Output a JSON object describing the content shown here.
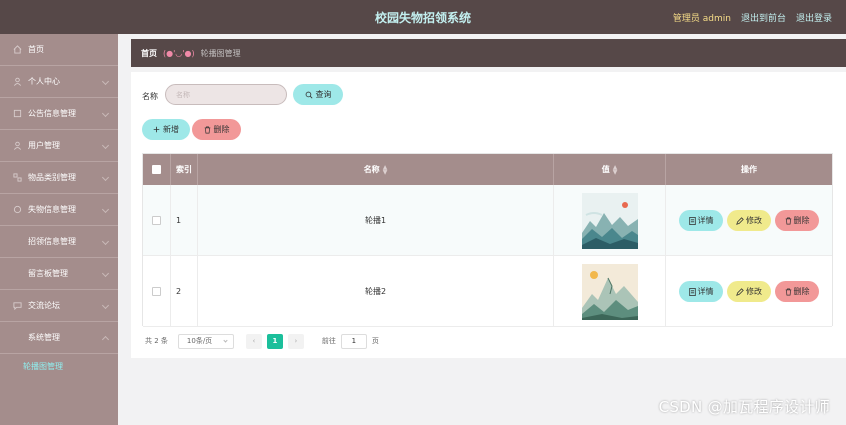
{
  "header": {
    "title": "校园失物招领系统",
    "admin_label": "管理员 admin",
    "back_label": "退出到前台",
    "logout_label": "退出登录"
  },
  "sidebar": {
    "items": [
      {
        "label": "首页",
        "icon": "home-icon"
      },
      {
        "label": "个人中心",
        "icon": "user-icon"
      },
      {
        "label": "公告信息管理",
        "icon": "notice-icon"
      },
      {
        "label": "用户管理",
        "icon": "users-icon"
      },
      {
        "label": "物品类别管理",
        "icon": "category-icon"
      },
      {
        "label": "失物信息管理",
        "icon": "lost-icon"
      },
      {
        "label": "招领信息管理"
      },
      {
        "label": "留言板管理"
      },
      {
        "label": "交流论坛",
        "icon": "forum-icon"
      },
      {
        "label": "系统管理"
      },
      {
        "label": "轮播图管理"
      }
    ]
  },
  "breadcrumb": {
    "home": "首页",
    "face": "(●'◡'●)",
    "current": "轮播图管理"
  },
  "search": {
    "label": "名称",
    "placeholder": "名称",
    "query_label": "查询"
  },
  "toolbar": {
    "add_label": "新增",
    "delete_label": "删除"
  },
  "table": {
    "columns": {
      "index": "索引",
      "name": "名称",
      "value": "值",
      "action": "操作"
    },
    "rows": [
      {
        "index": "1",
        "name": "轮播1"
      },
      {
        "index": "2",
        "name": "轮播2"
      }
    ],
    "actions": {
      "detail": "详情",
      "edit": "修改",
      "delete": "删除"
    }
  },
  "pagination": {
    "total": "共 2 条",
    "page_size": "10条/页",
    "current_page": "1",
    "goto_label": "前往",
    "goto_value": "1",
    "page_suffix": "页"
  },
  "watermark": "CSDN @加瓦程序设计师",
  "colors": {
    "topbar": "#564848",
    "sidebar": "#a48d8c",
    "accent_cyan": "#9ee8e8",
    "accent_red": "#f29898",
    "accent_yellow": "#f0ea8c",
    "pager_active": "#1bbf9b"
  }
}
